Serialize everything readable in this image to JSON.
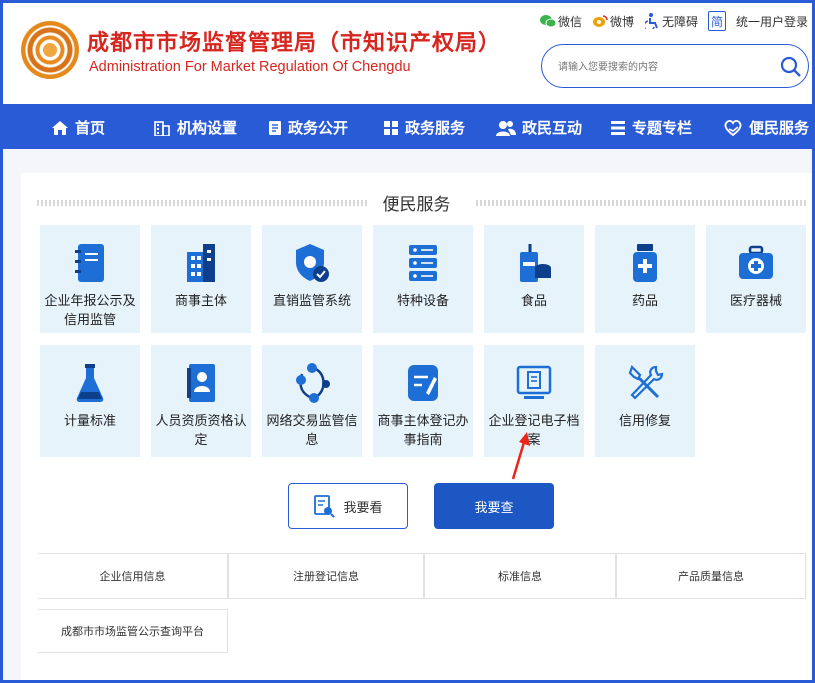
{
  "header": {
    "title_cn": "成都市市场监督管理局（市知识产权局）",
    "title_en": "Administration For Market Regulation Of Chengdu",
    "links": {
      "wechat": "微信",
      "weibo": "微博",
      "accessible": "无障碍",
      "simplified": "简",
      "login": "统一用户登录"
    },
    "search": {
      "placeholder": "请输入您要搜索的内容"
    }
  },
  "nav": {
    "items": [
      {
        "label": "首页",
        "icon": "home-icon"
      },
      {
        "label": "机构设置",
        "icon": "building-icon"
      },
      {
        "label": "政务公开",
        "icon": "document-icon"
      },
      {
        "label": "政务服务",
        "icon": "grid-icon"
      },
      {
        "label": "政民互动",
        "icon": "people-icon"
      },
      {
        "label": "专题专栏",
        "icon": "list-icon"
      },
      {
        "label": "便民服务",
        "icon": "heart-hand-icon"
      }
    ]
  },
  "section": {
    "title": "便民服务"
  },
  "tiles_row1": [
    {
      "label": "企业年报公示及信用监管"
    },
    {
      "label": "商事主体"
    },
    {
      "label": "直销监管系统"
    },
    {
      "label": "特种设备"
    },
    {
      "label": "食品"
    },
    {
      "label": "药品"
    },
    {
      "label": "医疗器械"
    }
  ],
  "tiles_row2": [
    {
      "label": "计量标准"
    },
    {
      "label": "人员资质资格认定"
    },
    {
      "label": "网络交易监管信息"
    },
    {
      "label": "商事主体登记办事指南"
    },
    {
      "label": "企业登记电子档案"
    },
    {
      "label": "信用修复"
    }
  ],
  "buttons": {
    "look": "我要看",
    "check": "我要查"
  },
  "query_links": [
    "企业信用信息",
    "注册登记信息",
    "标准信息",
    "产品质量信息",
    "成都市市场监管公示查询平台"
  ],
  "colors": {
    "brand_red": "#d7261f",
    "nav_blue": "#2a5bd7",
    "tile_bg": "#e6f3fb",
    "arrow_red": "#e8261c"
  }
}
